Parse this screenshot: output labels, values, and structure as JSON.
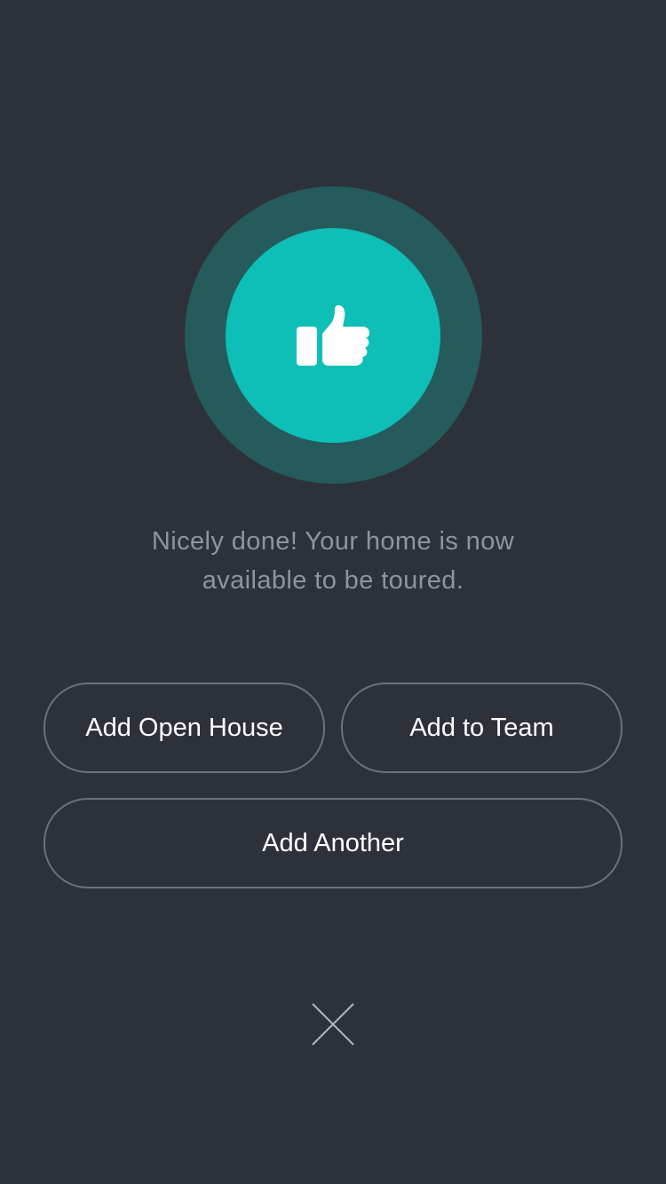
{
  "badge": {
    "icon": "thumbs-up-icon",
    "colors": {
      "outer_ring": "#255b5d",
      "inner_circle": "#0dbfb6",
      "icon": "#ffffff"
    }
  },
  "message": {
    "line1": "Nicely done! Your home is now",
    "line2": "available to be toured."
  },
  "actions": {
    "open_house_label": "Add Open House",
    "team_label": "Add to Team",
    "another_label": "Add Another"
  },
  "close": {
    "icon": "close-icon"
  },
  "colors": {
    "background": "#2d313a",
    "message_text": "#8f949d",
    "button_border": "#6c7079",
    "button_text": "#ffffff"
  }
}
